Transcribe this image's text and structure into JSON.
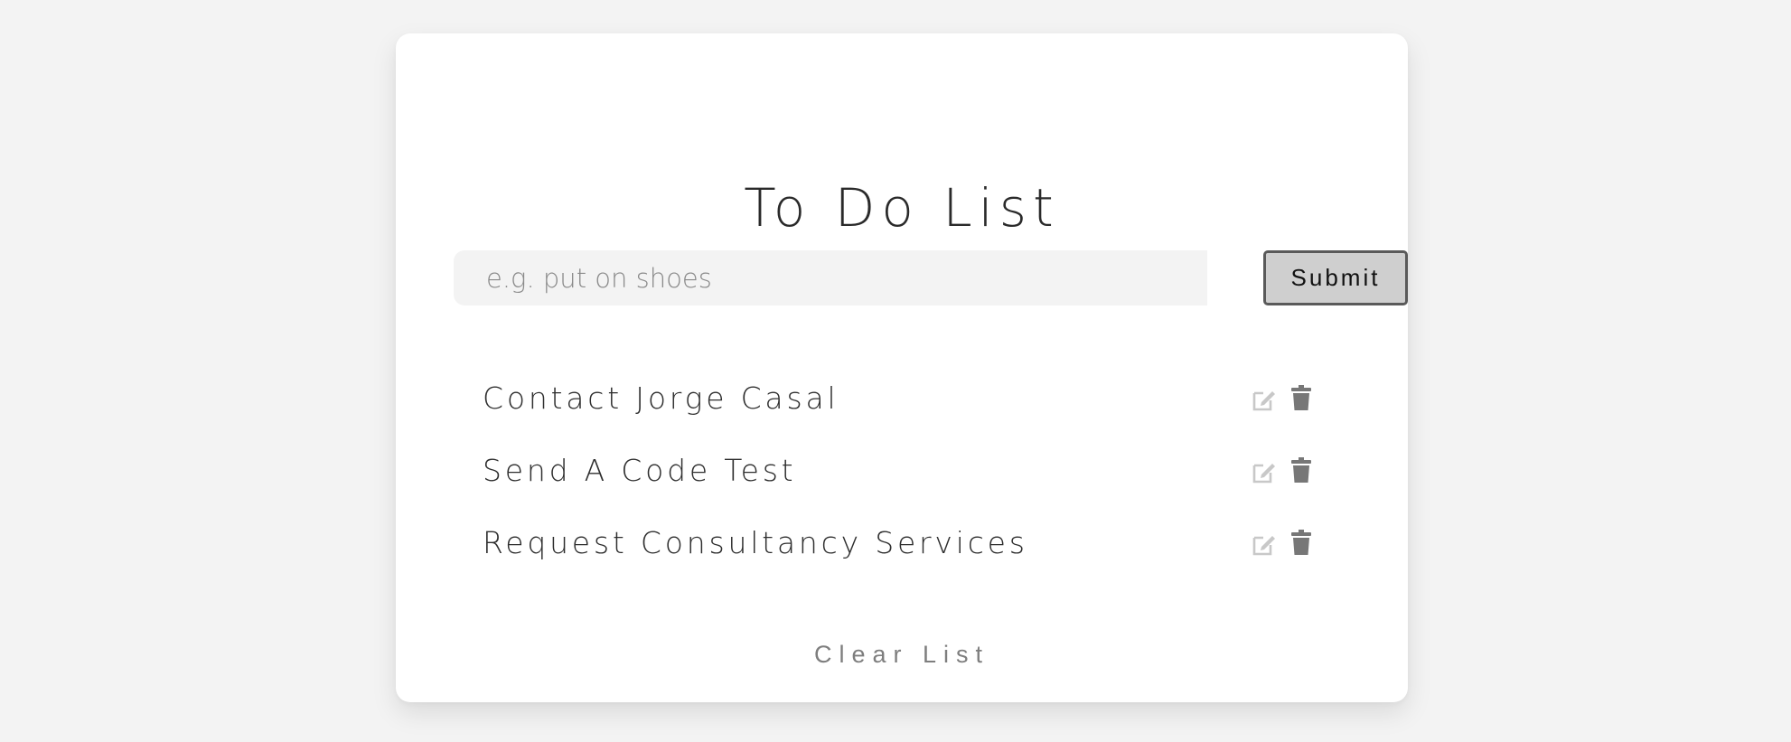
{
  "title": "To Do List",
  "form": {
    "input_value": "",
    "input_placeholder": "e.g. put on shoes",
    "submit_label": "Submit"
  },
  "tasks": [
    {
      "text": "Contact Jorge Casal",
      "edit_icon": "edit-icon",
      "delete_icon": "trash-icon"
    },
    {
      "text": "Send A Code Test",
      "edit_icon": "edit-icon",
      "delete_icon": "trash-icon"
    },
    {
      "text": "Request Consultancy Services",
      "edit_icon": "edit-icon",
      "delete_icon": "trash-icon"
    }
  ],
  "clear_label": "Clear List",
  "colors": {
    "background": "#f3f3f3",
    "card": "#ffffff",
    "title": "#2a2a2a",
    "submit_bg": "#cfcfcf",
    "submit_border": "#5a5a5a",
    "edit_icon": "#c8c8c8",
    "trash_icon": "#777777",
    "clear_text": "#7e7e7e"
  }
}
